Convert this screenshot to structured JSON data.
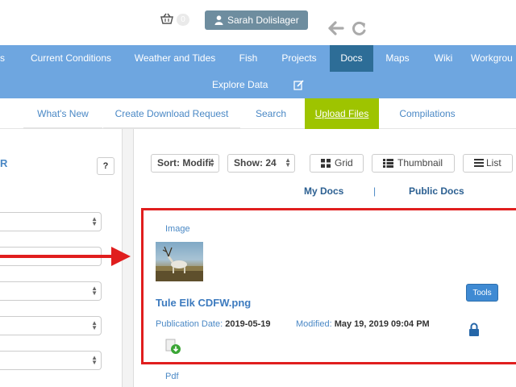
{
  "topbar": {
    "cart_count": "0",
    "user_name": "Sarah Dolislager"
  },
  "main_nav": {
    "items": [
      {
        "label": "s"
      },
      {
        "label": "Current Conditions"
      },
      {
        "label": "Weather and Tides"
      },
      {
        "label": "Fish"
      },
      {
        "label": "Projects"
      },
      {
        "label": "Docs",
        "active": true
      },
      {
        "label": "Maps"
      },
      {
        "label": "Wiki"
      },
      {
        "label": "Workgrou"
      }
    ],
    "row2": {
      "label": "Explore Data"
    }
  },
  "sub_nav": {
    "items": [
      {
        "label": "What's New"
      },
      {
        "label": "Create Download Request"
      },
      {
        "label": "Search"
      },
      {
        "label": "Upload Files",
        "active": true
      },
      {
        "label": "Compilations"
      }
    ]
  },
  "left_panel": {
    "title": "R",
    "help_label": "?"
  },
  "controls": {
    "sort_label": "Sort: Modifi",
    "show_label": "Show: 24",
    "grid_label": "Grid",
    "thumbnail_label": "Thumbnail",
    "list_label": "List"
  },
  "doc_tabs": {
    "my_docs": "My Docs",
    "separator": "|",
    "public_docs": "Public Docs"
  },
  "document": {
    "type": "Image",
    "file_name": "Tule Elk CDFW.png",
    "publication_label": "Publication Date:",
    "publication_date": "2019-05-19",
    "modified_label": "Modified:",
    "modified_date": "May 19, 2019 09:04 PM",
    "tools_label": "Tools"
  },
  "next_document": {
    "type": "Pdf"
  },
  "colors": {
    "nav_bg": "#6ea6e0",
    "nav_active": "#2d6d97",
    "upload_active": "#9ec400",
    "link": "#4a88c5",
    "highlight_red": "#e01e1e"
  }
}
